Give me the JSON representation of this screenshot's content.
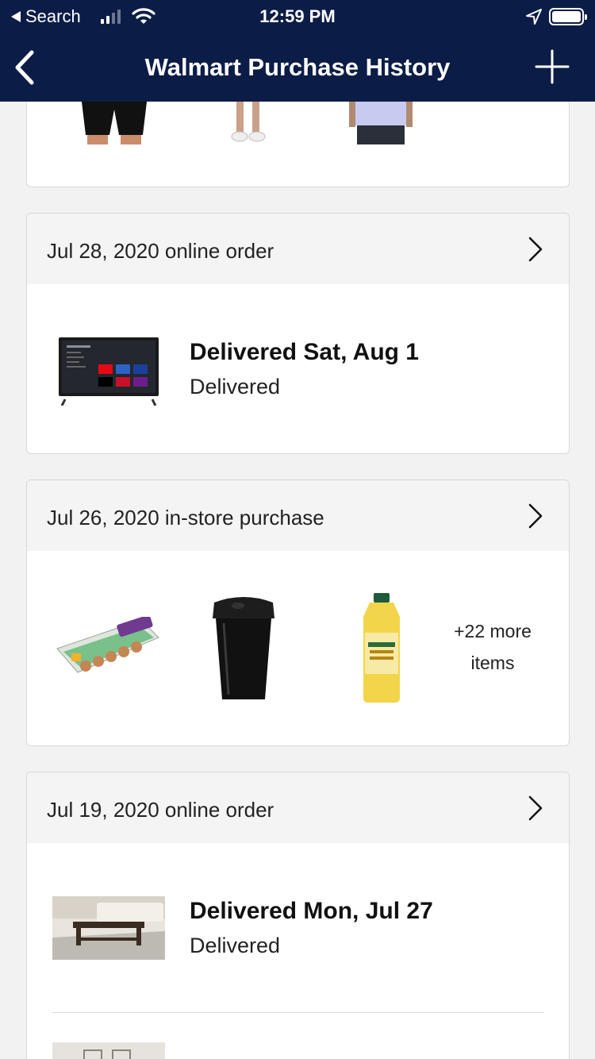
{
  "status_bar": {
    "back_app": "Search",
    "time": "12:59 PM",
    "signal_bars": 2
  },
  "nav": {
    "title": "Walmart Purchase History",
    "back_icon": "chevron-left-icon",
    "add_icon": "plus-icon"
  },
  "orders": [
    {
      "header": "Jul 28, 2020 online order",
      "status_title": "Delivered  Sat, Aug 1",
      "status_sub": "Delivered",
      "item": "tv-thumbnail"
    },
    {
      "header": "Jul 26, 2020 in-store purchase",
      "items": [
        "eggs-thumbnail",
        "trash-can-thumbnail",
        "oil-bottle-thumbnail"
      ],
      "more_line1": "+22 more",
      "more_line2": "items"
    },
    {
      "header": "Jul 19, 2020 online order",
      "status_title": "Delivered  Mon, Jul 27",
      "status_sub": "Delivered",
      "item": "coffee-table-thumbnail"
    }
  ],
  "colors": {
    "nav_bg": "#0b1d47",
    "card_header_bg": "#f4f4f4",
    "page_bg": "#f2f2f2"
  }
}
